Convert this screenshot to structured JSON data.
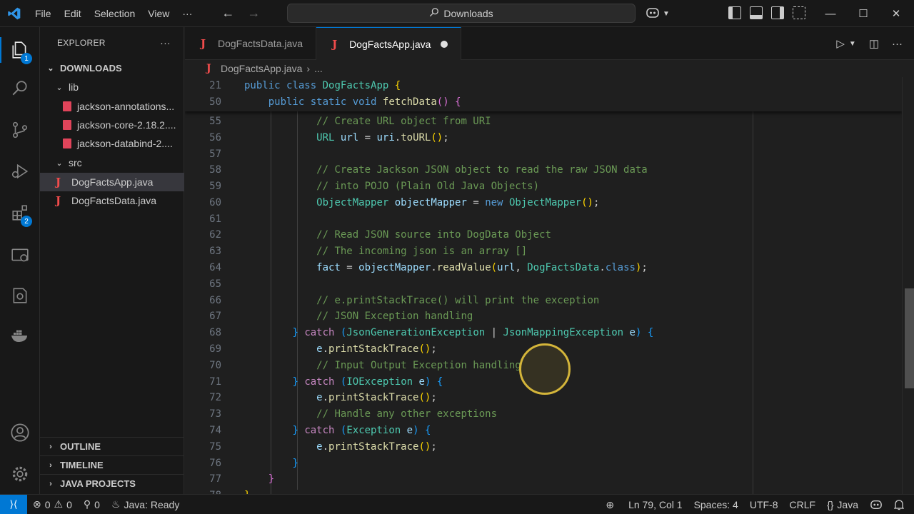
{
  "menu": [
    "File",
    "Edit",
    "Selection",
    "View",
    "···"
  ],
  "search": {
    "text": "Downloads"
  },
  "window_controls": [
    "—",
    "☐",
    "✕"
  ],
  "activity_badges": {
    "explorer": "1",
    "extensions": "2"
  },
  "explorer": {
    "title": "EXPLORER",
    "more": "···",
    "root": "DOWNLOADS",
    "lib": "lib",
    "jars": [
      "jackson-annotations...",
      "jackson-core-2.18.2....",
      "jackson-databind-2...."
    ],
    "src": "src",
    "files": [
      "DogFactsApp.java",
      "DogFactsData.java"
    ],
    "sections": [
      "OUTLINE",
      "TIMELINE",
      "JAVA PROJECTS"
    ]
  },
  "tabs": [
    {
      "label": "DogFactsData.java"
    },
    {
      "label": "DogFactsApp.java",
      "active": true,
      "dirty": true
    }
  ],
  "breadcrumb": {
    "file": "DogFactsApp.java",
    "rest": "..."
  },
  "colors": {
    "accent": "#0078d4",
    "keyword": "#569cd6",
    "type": "#4ec9b0",
    "function": "#dcdcaa",
    "variable": "#9cdcfe",
    "comment": "#6a9955",
    "cursor_highlight": "#d4b53a"
  },
  "status": {
    "errors": "0",
    "warnings": "0",
    "ports": "0",
    "java": "Java: Ready",
    "position": "Ln 79, Col 1",
    "spaces": "Spaces: 4",
    "encoding": "UTF-8",
    "eol": "CRLF",
    "language": "Java"
  }
}
